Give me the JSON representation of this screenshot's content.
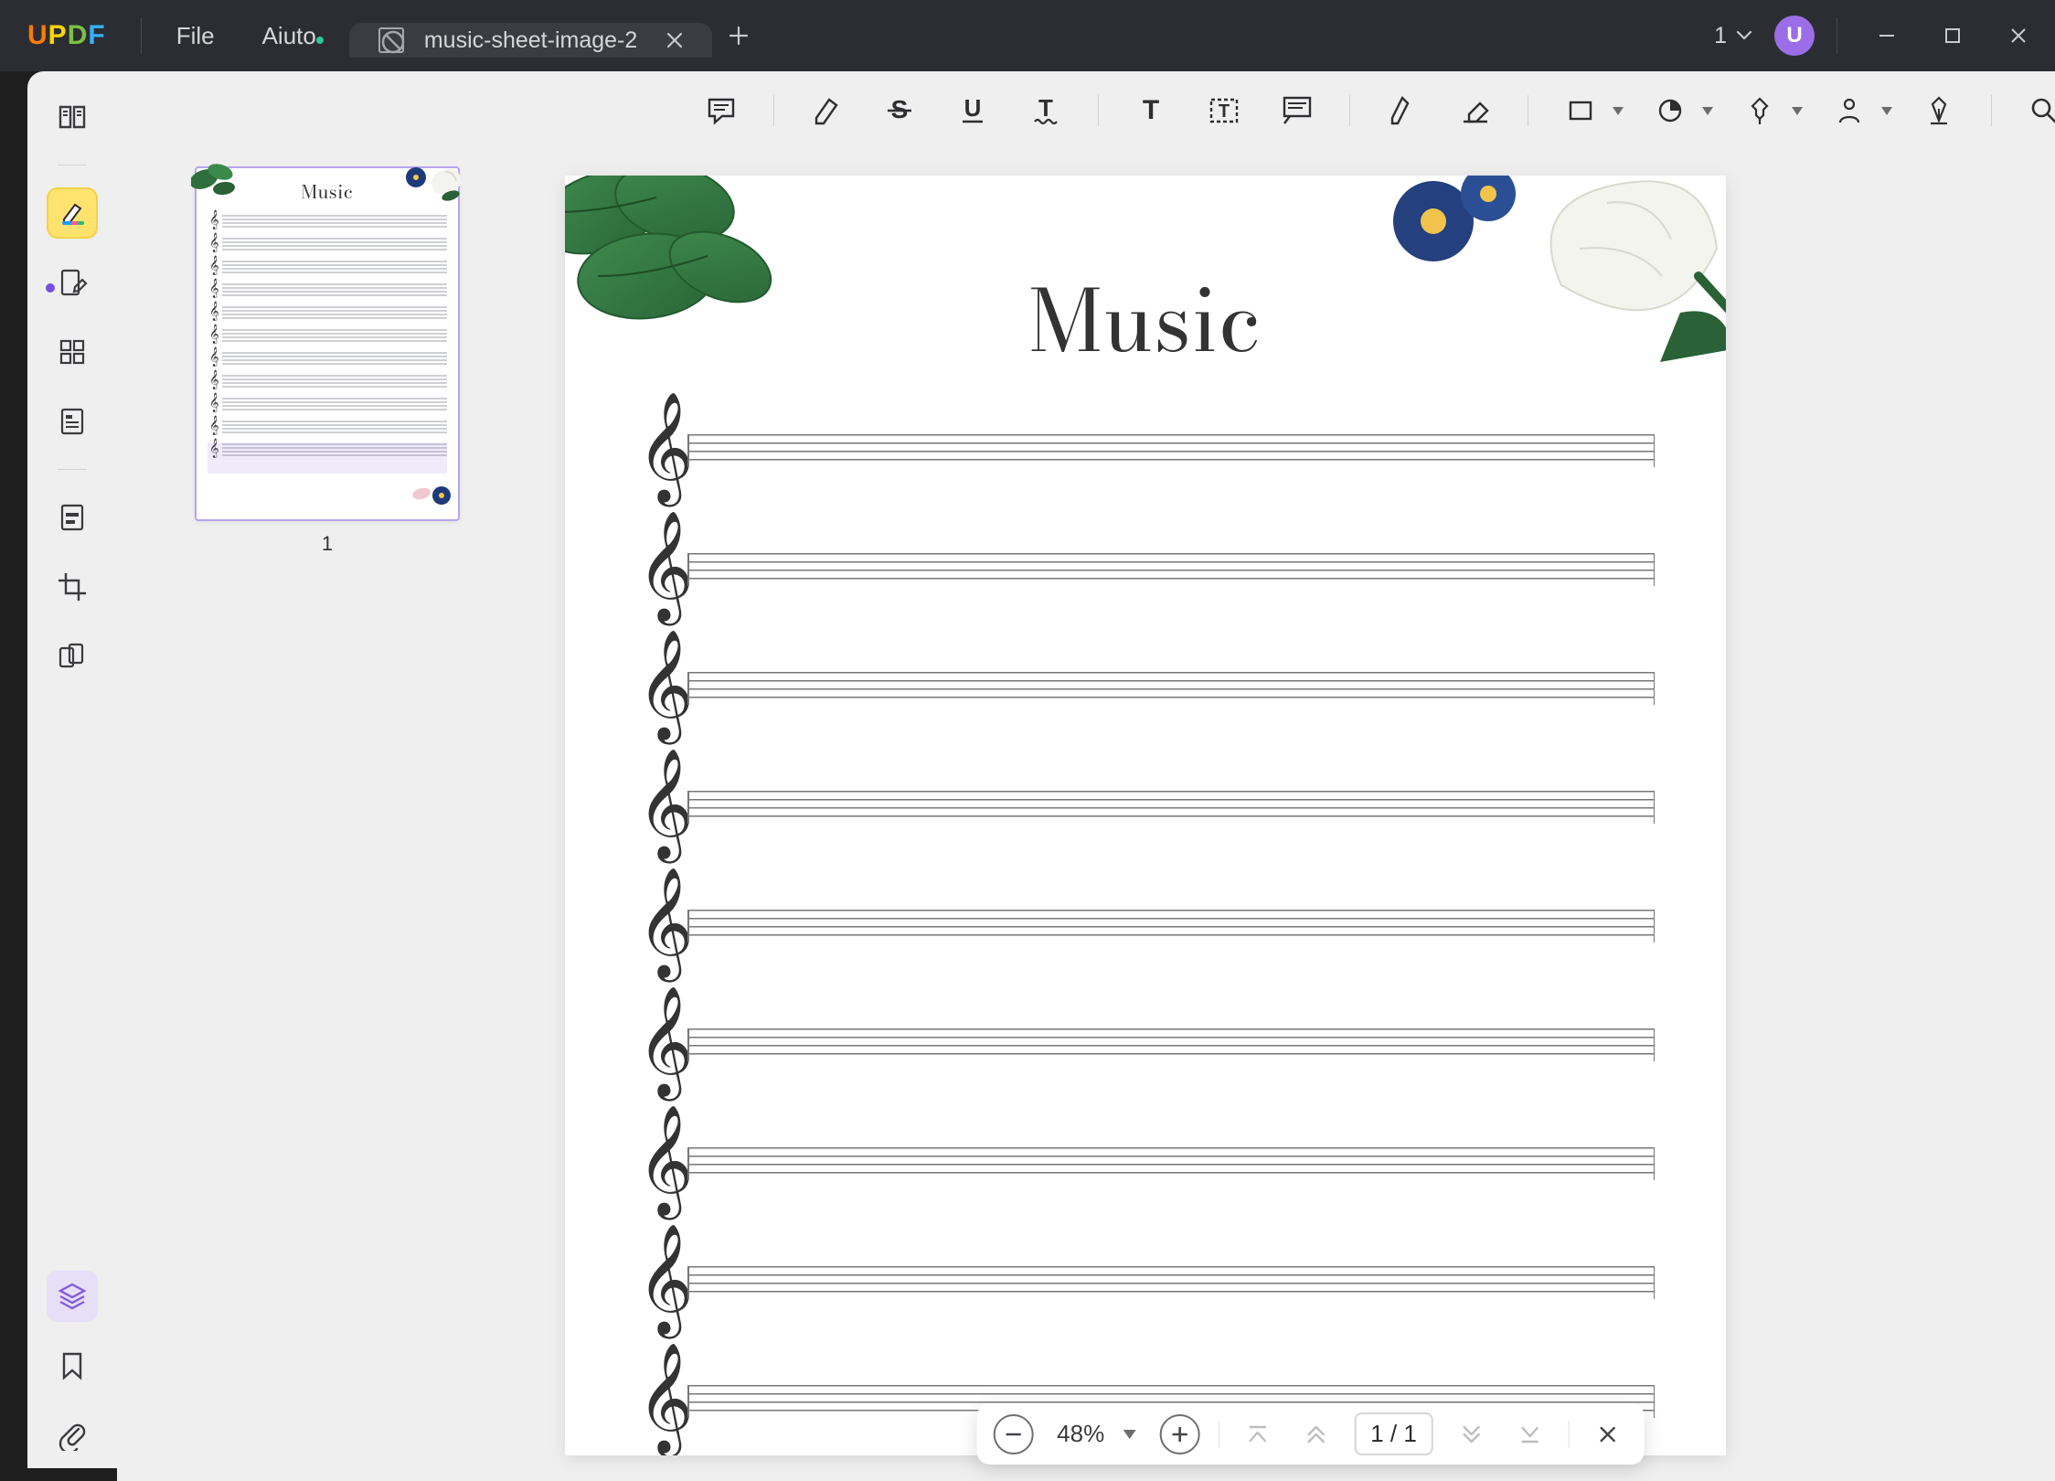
{
  "app": {
    "logo": [
      "U",
      "P",
      "D",
      "F"
    ]
  },
  "menu": {
    "file": "File",
    "help": "Aiuto"
  },
  "tabs": {
    "active_title": "music-sheet-image-2"
  },
  "titlebar_right": {
    "docs_count": "1",
    "avatar_initial": "U"
  },
  "document": {
    "title": "Music",
    "staff_rows": 9,
    "thumbnail": {
      "page_number": "1",
      "selected": true,
      "mini_rows": 11
    }
  },
  "zoom_bar": {
    "zoom_value": "48%",
    "page_current": "1",
    "page_total": "1",
    "page_display": "1 / 1"
  }
}
